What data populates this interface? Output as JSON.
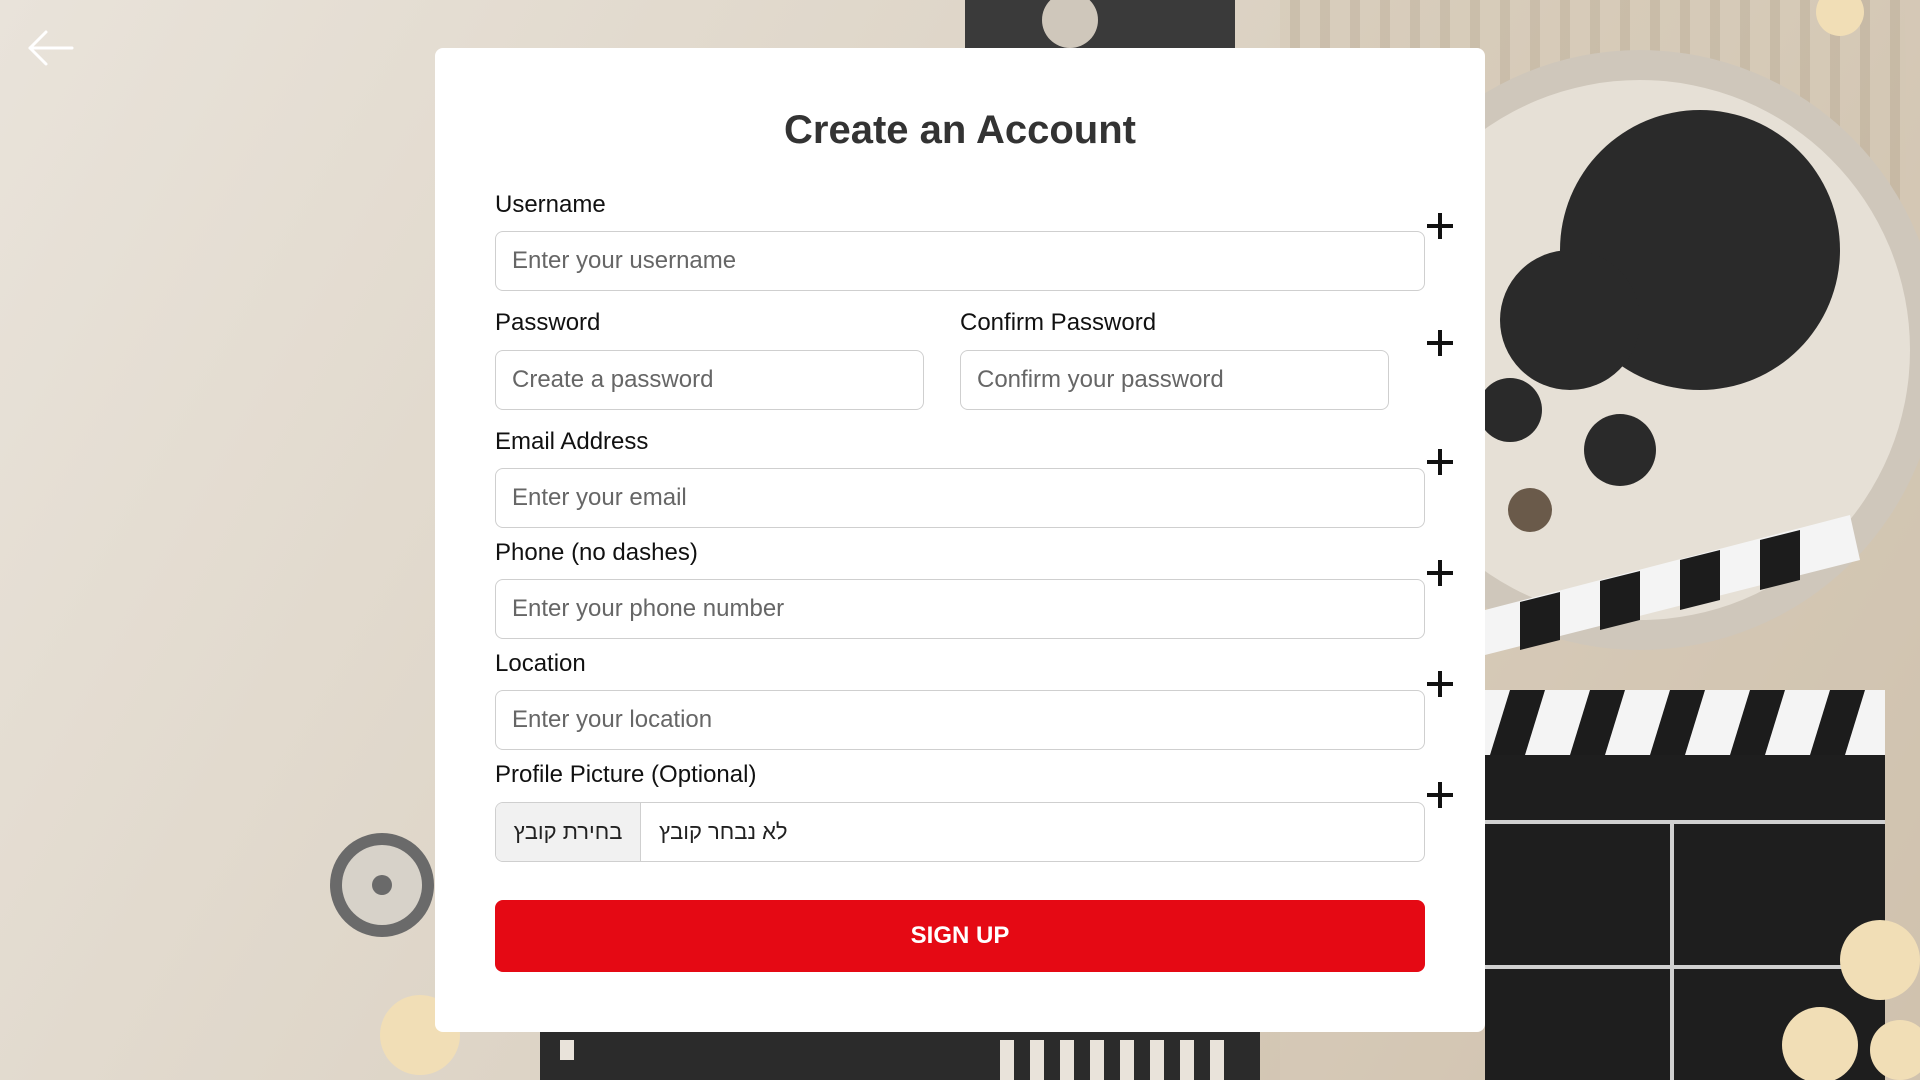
{
  "page": {
    "title": "Create an Account",
    "accent_color": "#e50914",
    "back_icon": "arrow-left-icon"
  },
  "form": {
    "username": {
      "label": "Username",
      "placeholder": "Enter your username"
    },
    "password": {
      "label": "Password",
      "placeholder": "Create a password"
    },
    "confirm_password": {
      "label": "Confirm Password",
      "placeholder": "Confirm your password"
    },
    "email": {
      "label": "Email Address",
      "placeholder": "Enter your email"
    },
    "phone": {
      "label": "Phone (no dashes)",
      "placeholder": "Enter your phone number"
    },
    "location": {
      "label": "Location",
      "placeholder": "Enter your location"
    },
    "profile_picture": {
      "label": "Profile Picture (Optional)",
      "choose_button": "בחירת קובץ",
      "status": "לא נבחר קובץ"
    },
    "add_icon": "plus-icon",
    "submit_label": "SIGN UP"
  }
}
